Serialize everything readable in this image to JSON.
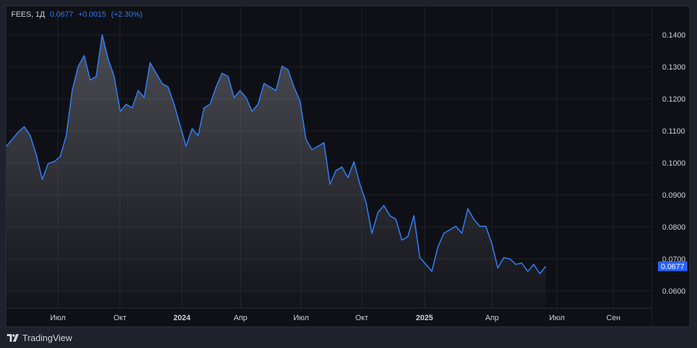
{
  "header": {
    "symbol": "FEES, 1Д",
    "price": "0.0677",
    "change": "+0.0015",
    "change_pct": "(+2.30%)"
  },
  "branding": {
    "name": "TradingView"
  },
  "colors": {
    "line": "#2f7bf5",
    "price_label": "#2962ff",
    "background": "#0f1015"
  },
  "chart_data": {
    "type": "area",
    "title": "FEES, 1Д",
    "xlabel": "",
    "ylabel": "",
    "ylim": [
      0.0545,
      0.149
    ],
    "yticks": [
      "0.1400",
      "0.1300",
      "0.1200",
      "0.1100",
      "0.1000",
      "0.0900",
      "0.0800",
      "0.0700",
      "0.0600"
    ],
    "xticks": [
      "Июл",
      "Окт",
      "2024",
      "Апр",
      "Июл",
      "Окт",
      "2025",
      "Апр",
      "Июл",
      "Сен"
    ],
    "last_price_label": "0.0677",
    "grid": true,
    "series": [
      {
        "name": "FEES",
        "values": [
          0.1052,
          0.1074,
          0.1096,
          0.1113,
          0.1085,
          0.1026,
          0.0948,
          0.0998,
          0.1004,
          0.102,
          0.1085,
          0.1226,
          0.1302,
          0.1335,
          0.1259,
          0.127,
          0.14,
          0.1324,
          0.127,
          0.1161,
          0.1183,
          0.1172,
          0.1226,
          0.1204,
          0.1313,
          0.128,
          0.1248,
          0.1237,
          0.1183,
          0.1117,
          0.1052,
          0.1107,
          0.1085,
          0.1172,
          0.1183,
          0.1237,
          0.128,
          0.127,
          0.1204,
          0.1226,
          0.1204,
          0.1161,
          0.1183,
          0.1248,
          0.1237,
          0.1226,
          0.1302,
          0.1291,
          0.1237,
          0.1194,
          0.1074,
          0.1041,
          0.1052,
          0.1063,
          0.0933,
          0.0976,
          0.0987,
          0.0954,
          0.1004,
          0.0933,
          0.0878,
          0.078,
          0.0845,
          0.0867,
          0.0835,
          0.0824,
          0.0759,
          0.077,
          0.0835,
          0.0704,
          0.0683,
          0.0661,
          0.0737,
          0.078,
          0.0791,
          0.0802,
          0.078,
          0.0857,
          0.0824,
          0.0802,
          0.0802,
          0.0748,
          0.0672,
          0.0704,
          0.07,
          0.0683,
          0.0687,
          0.0661,
          0.0683,
          0.0654,
          0.0677
        ]
      }
    ]
  }
}
